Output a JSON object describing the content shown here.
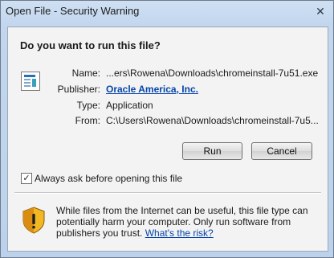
{
  "window": {
    "title": "Open File - Security Warning",
    "close_symbol": "✕"
  },
  "heading": "Do you want to run this file?",
  "details": {
    "name_label": "Name:",
    "name_value": "...ers\\Rowena\\Downloads\\chromeinstall-7u51.exe",
    "publisher_label": "Publisher:",
    "publisher_value": "Oracle America, Inc.",
    "type_label": "Type:",
    "type_value": "Application",
    "from_label": "From:",
    "from_value": "C:\\Users\\Rowena\\Downloads\\chromeinstall-7u5..."
  },
  "buttons": {
    "run": "Run",
    "cancel": "Cancel"
  },
  "checkbox": {
    "label": "Always ask before opening this file",
    "checked": true,
    "mark": "✓"
  },
  "warning": {
    "text": "While files from the Internet can be useful, this file type can potentially harm your computer. Only run software from publishers you trust.",
    "link": "What's the risk?"
  },
  "icons": {
    "file": "application-file-icon",
    "shield": "warning-shield-icon"
  },
  "colors": {
    "link": "#0645a8",
    "frame": "#bcd2ec",
    "shield_gold": "#e8a317"
  }
}
